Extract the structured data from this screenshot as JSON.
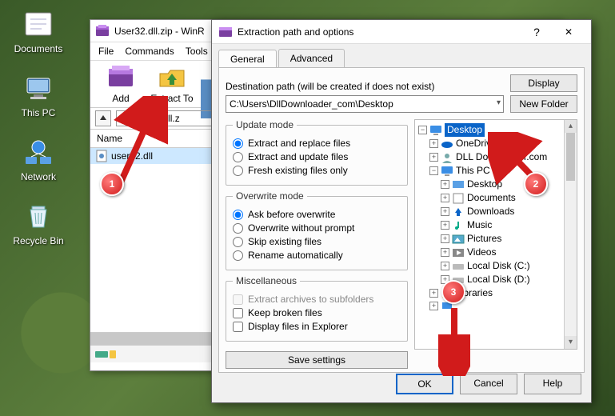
{
  "desktop": {
    "documents": "Documents",
    "thispc": "This PC",
    "network": "Network",
    "recycle": "Recycle Bin"
  },
  "winrar": {
    "title": "User32.dll.zip - WinR",
    "menu": {
      "file": "File",
      "commands": "Commands",
      "tools": "Tools"
    },
    "toolbar": {
      "add": "Add",
      "extract": "Extract To"
    },
    "path_field": "ser32.dll.z",
    "list": {
      "header_name": "Name",
      "row0": "user32.dll"
    }
  },
  "dialog": {
    "title": "Extraction path and options",
    "tabs": {
      "general": "General",
      "advanced": "Advanced"
    },
    "dest_label": "Destination path (will be created if does not exist)",
    "dest_value": "C:\\Users\\DllDownloader_com\\Desktop",
    "btn_display": "Display",
    "btn_newfolder": "New Folder",
    "group_update": "Update mode",
    "update_opts": {
      "a": "Extract and replace files",
      "b": "Extract and update files",
      "c": "Fresh existing files only"
    },
    "group_overwrite": "Overwrite mode",
    "overwrite_opts": {
      "a": "Ask before overwrite",
      "b": "Overwrite without prompt",
      "c": "Skip existing files",
      "d": "Rename automatically"
    },
    "group_misc": "Miscellaneous",
    "misc_opts": {
      "a": "Extract archives to subfolders",
      "b": "Keep broken files",
      "c": "Display files in Explorer"
    },
    "btn_save": "Save settings",
    "tree": {
      "desktop": "Desktop",
      "onedrive": "OneDrive",
      "dlldown": "DLL Downloader.com",
      "thispc": "This PC",
      "t_desktop": "Desktop",
      "t_documents": "Documents",
      "t_downloads": "Downloads",
      "t_music": "Music",
      "t_pictures": "Pictures",
      "t_videos": "Videos",
      "t_diskc": "Local Disk (C:)",
      "t_diskd": "Local Disk (D:)",
      "libraries": "Libraries"
    },
    "btn_ok": "OK",
    "btn_cancel": "Cancel",
    "btn_help": "Help"
  },
  "annotations": {
    "n1": "1",
    "n2": "2",
    "n3": "3"
  }
}
